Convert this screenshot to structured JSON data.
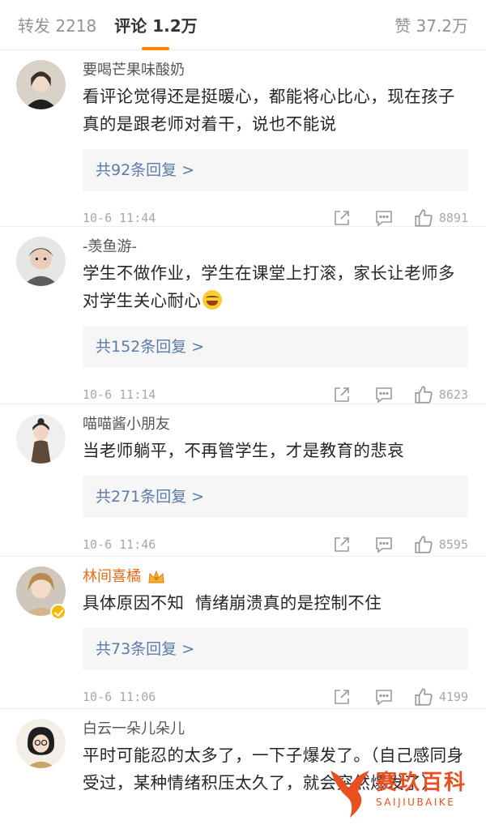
{
  "tabs": [
    {
      "label": "转发 2218"
    },
    {
      "label": "评论 1.2万"
    },
    {
      "label": "赞 37.2万"
    }
  ],
  "comments": [
    {
      "username": "要喝芒果味酸奶",
      "text": "看评论觉得还是挺暖心，都能将心比心，现在孩子真的是跟老师对着干，说也不能说",
      "replies": "共92条回复 >",
      "time": "10-6 11:44",
      "likes": "8891"
    },
    {
      "username": "-羡鱼游-",
      "text": "学生不做作业，学生在课堂上打滚，家长让老师多对学生关心耐心",
      "emoji": "laughing-tears-emoji",
      "replies": "共152条回复 >",
      "time": "10-6 11:14",
      "likes": "8623"
    },
    {
      "username": "喵喵酱小朋友",
      "text": "当老师躺平，不再管学生，才是教育的悲哀",
      "replies": "共271条回复 >",
      "time": "10-6 11:46",
      "likes": "8595"
    },
    {
      "username": "林间喜橘",
      "vip": true,
      "text": "具体原因不知  情绪崩溃真的是控制不住",
      "replies": "共73条回复 >",
      "time": "10-6 11:06",
      "likes": "4199"
    },
    {
      "username": "白云一朵儿朵儿",
      "text": "平时可能忍的太多了，一下子爆发了。（自己感同身受过，某种情绪积压太久了，就会突然爆发了）"
    }
  ],
  "watermark": {
    "title": "赛玖百科",
    "subtitle": "SAIJIUBAIKE"
  },
  "colors": {
    "accent": "#ff8200",
    "reply_link": "#5b7ba8",
    "vip_name": "#e86b1c",
    "watermark": "#e8501f"
  }
}
